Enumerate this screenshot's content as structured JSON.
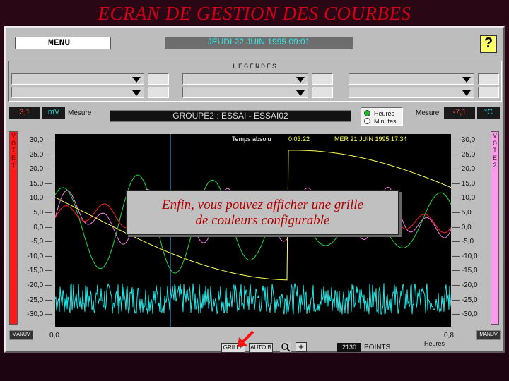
{
  "page_title": "ECRAN DE GESTION DES COURBES",
  "header": {
    "menu_label": "MENU",
    "datetime": "JEUDI 22 JUIN 1995 09:01",
    "help_label": "?"
  },
  "legend": {
    "title": "LEGENDES"
  },
  "measure_bar": {
    "left_value": "3,1",
    "left_unit": "mV",
    "left_label": "Mesure",
    "group_title": "GROUPE2 : ESSAI - ESSAI02",
    "radio_hours": "Heures",
    "radio_minutes": "Minutes",
    "selected_unit": "Heures",
    "right_label": "Mesure",
    "right_value": "-7,1",
    "right_unit": "°C"
  },
  "channels": {
    "voie1": "VOIE1",
    "voie2": "VOIE2"
  },
  "plot": {
    "header_label": "Temps absolu",
    "header_time": "0:03:22",
    "header_date": "MER 21 JUIN 1995 17:34",
    "y_ticks": [
      "30,0",
      "25,0",
      "20,0",
      "15,0",
      "10,0",
      "5,0",
      "0,0",
      "-5,0",
      "-10,0",
      "-15,0",
      "-20,0",
      "-25,0",
      "-30,0"
    ],
    "y_range": [
      -30,
      30
    ],
    "x_ticks": [
      "0,0",
      "0,8"
    ],
    "x_unit": "Heures",
    "colors": {
      "background": "#000000",
      "green": "#22dd44",
      "pink": "#ff77ee",
      "red": "#ff2222",
      "yellow": "#ffff55",
      "cyan": "#22e6e6",
      "cursor": "#4aaaf0"
    }
  },
  "bottom_bar": {
    "manuv_left": "MANUV",
    "manuv_right": "MANUV",
    "grid_button": "GRILLE",
    "auto_button": "AUTO B",
    "zoom_icon": "zoom-icon",
    "plus_label": "+",
    "points_value": "2130",
    "points_label": "POINTS"
  },
  "callout": {
    "line1": "Enfin, vous pouvez afficher une grille",
    "line2": "de couleurs configurable"
  }
}
